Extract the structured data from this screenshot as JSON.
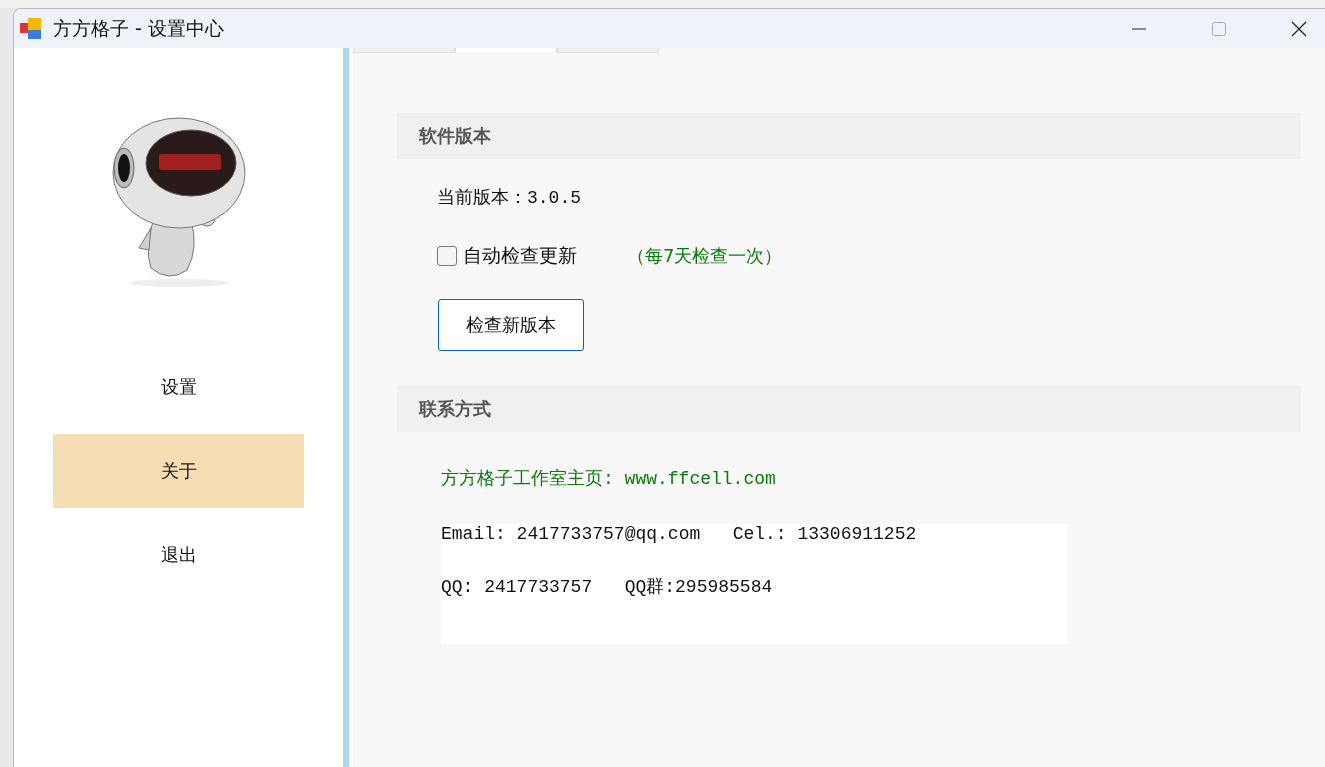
{
  "window": {
    "title": "方方格子 - 设置中心"
  },
  "sidebar": {
    "items": [
      {
        "label": "设置",
        "selected": false
      },
      {
        "label": "关于",
        "selected": true
      },
      {
        "label": "退出",
        "selected": false
      }
    ]
  },
  "tabs": [
    {
      "selected": false
    },
    {
      "selected": true
    },
    {
      "selected": false
    }
  ],
  "version_section": {
    "heading": "软件版本",
    "current_version": "当前版本：3.0.5",
    "auto_update": {
      "label": "自动检查更新",
      "checked": false,
      "note": "（每7天检查一次）"
    },
    "button": "检查新版本"
  },
  "contact_section": {
    "heading": "联系方式",
    "homepage": "方方格子工作室主页: www.ffcell.com",
    "details": [
      "Email: 2417733757@qq.com   Cel.: 13306911252",
      "QQ: 2417733757   QQ群:295985584"
    ]
  }
}
